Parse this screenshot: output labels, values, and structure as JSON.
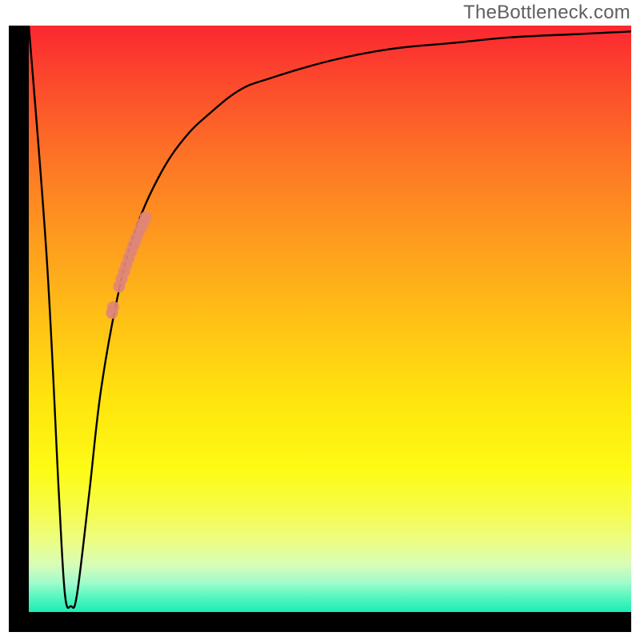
{
  "watermark": "TheBottleneck.com",
  "chart_data": {
    "type": "line",
    "title": "",
    "xlabel": "",
    "ylabel": "",
    "xlim": [
      0,
      100
    ],
    "ylim": [
      0,
      100
    ],
    "grid": false,
    "legend": false,
    "series": [
      {
        "name": "bottleneck-curve",
        "color": "#000000",
        "x": [
          0,
          3,
          5,
          6,
          7,
          8,
          10,
          12,
          15,
          18,
          22,
          26,
          30,
          35,
          40,
          50,
          60,
          70,
          80,
          90,
          100
        ],
        "y": [
          100,
          60,
          20,
          3,
          1,
          3,
          20,
          38,
          55,
          66,
          75,
          81,
          85,
          89,
          91,
          94,
          96,
          97,
          98,
          98.5,
          99
        ]
      }
    ],
    "markers": {
      "name": "highlight-cluster",
      "color": "#e08578",
      "points": [
        {
          "x": 15.0,
          "y": 55.5
        },
        {
          "x": 15.4,
          "y": 56.8
        },
        {
          "x": 15.8,
          "y": 58.0
        },
        {
          "x": 16.2,
          "y": 59.2
        },
        {
          "x": 16.6,
          "y": 60.4
        },
        {
          "x": 17.0,
          "y": 61.5
        },
        {
          "x": 17.4,
          "y": 62.6
        },
        {
          "x": 17.8,
          "y": 63.6
        },
        {
          "x": 18.2,
          "y": 64.6
        },
        {
          "x": 18.6,
          "y": 65.5
        },
        {
          "x": 19.0,
          "y": 66.4
        },
        {
          "x": 19.4,
          "y": 67.3
        },
        {
          "x": 13.8,
          "y": 51.0
        },
        {
          "x": 14.0,
          "y": 52.0
        }
      ]
    },
    "colors": {
      "curve": "#000000",
      "marker": "#e08578",
      "frame": "#000000"
    }
  }
}
